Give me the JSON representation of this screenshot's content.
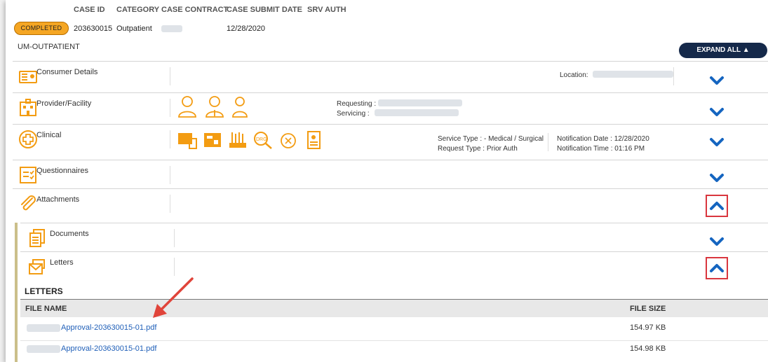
{
  "case_header": {
    "columns": [
      "CASE ID",
      "CATEGORY",
      "CASE CONTRACT",
      "CASE SUBMIT DATE",
      "SRV AUTH"
    ],
    "status_badge": "COMPLETED",
    "case_id": "203630015",
    "category": "Outpatient",
    "submit_date": "12/28/2020"
  },
  "section_title": "UM-OUTPATIENT",
  "expand_all_label": "EXPAND ALL",
  "rows": {
    "consumer": {
      "label": "Consumer Details",
      "location_label": "Location:"
    },
    "provider": {
      "label": "Provider/Facility",
      "requesting_label": "Requesting :",
      "servicing_label": "Servicing :"
    },
    "clinical": {
      "label": "Clinical",
      "service_type": "Service Type : - Medical / Surgical",
      "request_type": "Request Type : Prior Auth",
      "notification_date": "Notification Date : 12/28/2020",
      "notification_time": "Notification Time : 01:16 PM"
    },
    "questionnaires": {
      "label": "Questionnaires"
    },
    "attachments": {
      "label": "Attachments"
    },
    "documents": {
      "label": "Documents"
    },
    "letters": {
      "label": "Letters"
    }
  },
  "letters_table": {
    "title": "LETTERS",
    "col_file_name": "FILE NAME",
    "col_file_size": "FILE SIZE",
    "files": [
      {
        "name": "Approval-203630015-01.pdf",
        "size": "154.97 KB"
      },
      {
        "name": "Approval-203630015-01.pdf",
        "size": "154.98 KB"
      }
    ]
  },
  "colors": {
    "accent_orange": "#f5a623",
    "navy": "#15294a",
    "chevron_blue": "#1565c0",
    "highlight_red": "#d9363e"
  }
}
